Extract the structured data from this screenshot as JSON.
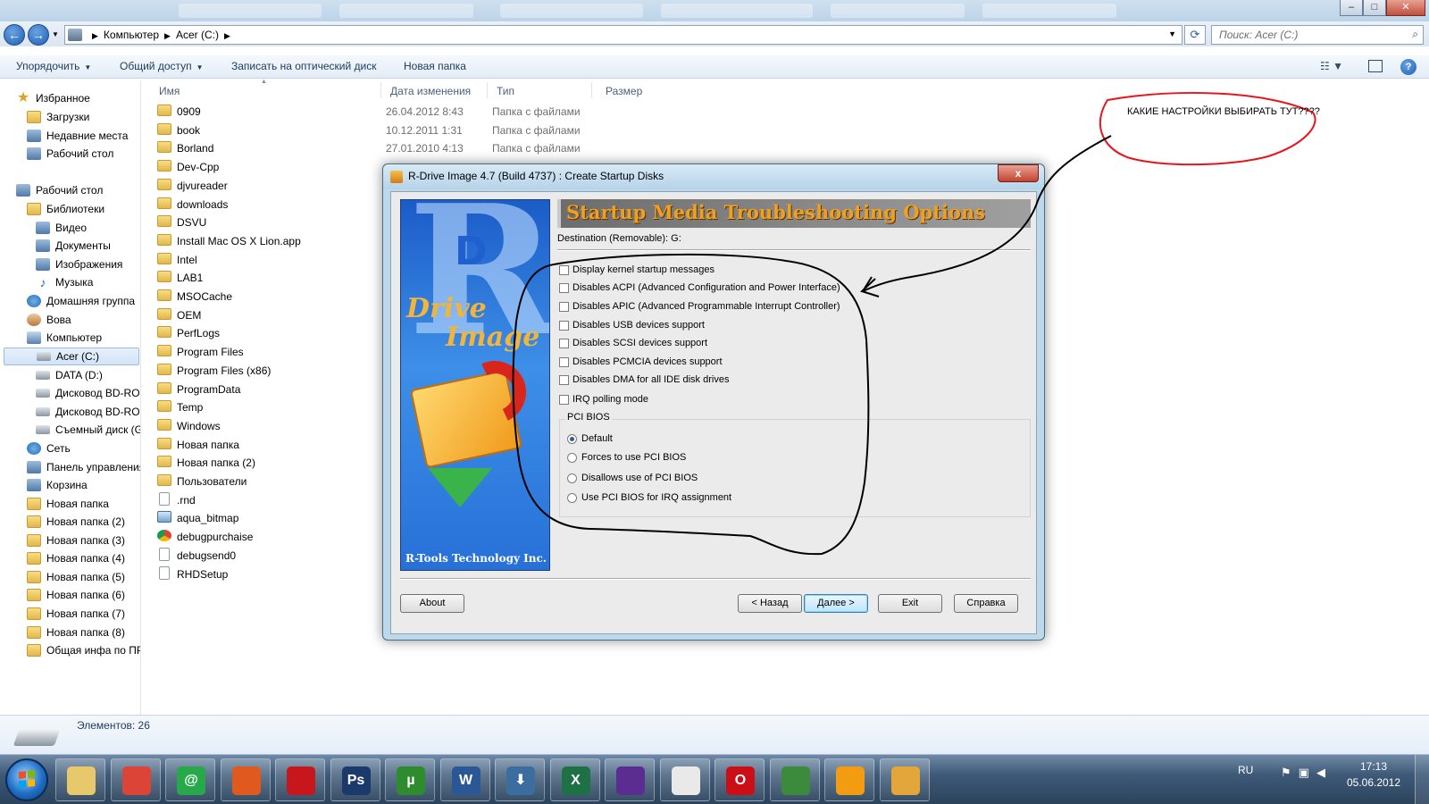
{
  "window": {
    "min": "–",
    "max": "□",
    "close": "✕"
  },
  "address": {
    "crumbs": [
      "Компьютер",
      "Acer (C:)"
    ],
    "search_placeholder": "Поиск: Acer (C:)"
  },
  "commands": [
    "Упорядочить",
    "Общий доступ",
    "Записать на оптический диск",
    "Новая папка"
  ],
  "nav": {
    "items": [
      {
        "label": "Избранное",
        "icon": "star"
      },
      {
        "label": "Загрузки",
        "icon": "folder"
      },
      {
        "label": "Недавние места",
        "icon": "sys"
      },
      {
        "label": "Рабочий стол",
        "icon": "sys"
      },
      {
        "label": "Рабочий стол",
        "icon": "sys"
      },
      {
        "label": "Библиотеки",
        "icon": "folder"
      },
      {
        "label": "Видео",
        "icon": "sys"
      },
      {
        "label": "Документы",
        "icon": "sys"
      },
      {
        "label": "Изображения",
        "icon": "sys"
      },
      {
        "label": "Музыка",
        "icon": "music"
      },
      {
        "label": "Домашняя группа",
        "icon": "net"
      },
      {
        "label": "Вова",
        "icon": "user"
      },
      {
        "label": "Компьютер",
        "icon": "pc"
      },
      {
        "label": "Acer (C:)",
        "icon": "drive"
      },
      {
        "label": "DATA (D:)",
        "icon": "drive"
      },
      {
        "label": "Дисковод BD-ROM",
        "icon": "drive"
      },
      {
        "label": "Дисковод BD-ROM",
        "icon": "drive"
      },
      {
        "label": "Съемный диск (G",
        "icon": "drive"
      },
      {
        "label": "Сеть",
        "icon": "net"
      },
      {
        "label": "Панель управления",
        "icon": "sys"
      },
      {
        "label": "Корзина",
        "icon": "sys"
      },
      {
        "label": "Новая папка",
        "icon": "folder"
      },
      {
        "label": "Новая папка (2)",
        "icon": "folder"
      },
      {
        "label": "Новая папка (3)",
        "icon": "folder"
      },
      {
        "label": "Новая папка (4)",
        "icon": "folder"
      },
      {
        "label": "Новая папка (5)",
        "icon": "folder"
      },
      {
        "label": "Новая папка (6)",
        "icon": "folder"
      },
      {
        "label": "Новая папка (7)",
        "icon": "folder"
      },
      {
        "label": "Новая папка (8)",
        "icon": "folder"
      },
      {
        "label": "Общая инфа по ПР",
        "icon": "folder"
      }
    ]
  },
  "columns": {
    "name": "Имя",
    "date": "Дата изменения",
    "type": "Тип",
    "size": "Размер"
  },
  "files": [
    {
      "name": "0909",
      "date": "26.04.2012 8:43",
      "type": "Папка с файлами",
      "icon": "folder"
    },
    {
      "name": "book",
      "date": "10.12.2011 1:31",
      "type": "Папка с файлами",
      "icon": "folder"
    },
    {
      "name": "Borland",
      "date": "27.01.2010 4:13",
      "type": "Папка с файлами",
      "icon": "folder"
    },
    {
      "name": "Dev-Cpp",
      "date": "",
      "type": "",
      "icon": "folder"
    },
    {
      "name": "djvureader",
      "date": "",
      "type": "",
      "icon": "folder"
    },
    {
      "name": "downloads",
      "date": "",
      "type": "",
      "icon": "folder"
    },
    {
      "name": "DSVU",
      "date": "",
      "type": "",
      "icon": "folder"
    },
    {
      "name": "Install Mac OS X Lion.app",
      "date": "",
      "type": "",
      "icon": "folder"
    },
    {
      "name": "Intel",
      "date": "",
      "type": "",
      "icon": "folder"
    },
    {
      "name": "LAB1",
      "date": "",
      "type": "",
      "icon": "folder"
    },
    {
      "name": "MSOCache",
      "date": "",
      "type": "",
      "icon": "folder"
    },
    {
      "name": "OEM",
      "date": "",
      "type": "",
      "icon": "folder"
    },
    {
      "name": "PerfLogs",
      "date": "",
      "type": "",
      "icon": "folder"
    },
    {
      "name": "Program Files",
      "date": "",
      "type": "",
      "icon": "folder"
    },
    {
      "name": "Program Files (x86)",
      "date": "",
      "type": "",
      "icon": "folder"
    },
    {
      "name": "ProgramData",
      "date": "",
      "type": "",
      "icon": "folder"
    },
    {
      "name": "Temp",
      "date": "",
      "type": "",
      "icon": "folder"
    },
    {
      "name": "Windows",
      "date": "",
      "type": "",
      "icon": "folder"
    },
    {
      "name": "Новая папка",
      "date": "",
      "type": "",
      "icon": "folder"
    },
    {
      "name": "Новая папка (2)",
      "date": "",
      "type": "",
      "icon": "folder"
    },
    {
      "name": "Пользователи",
      "date": "",
      "type": "",
      "icon": "folder"
    },
    {
      "name": ".rnd",
      "date": "",
      "type": "",
      "icon": "file"
    },
    {
      "name": "aqua_bitmap",
      "date": "",
      "type": "",
      "icon": "bmp"
    },
    {
      "name": "debugpurchaise",
      "date": "",
      "type": "",
      "icon": "chrome"
    },
    {
      "name": "debugsend0",
      "date": "",
      "type": "",
      "icon": "file"
    },
    {
      "name": "RHDSetup",
      "date": "",
      "type": "",
      "icon": "file"
    }
  ],
  "details": {
    "count": "Элементов: 26"
  },
  "dialog": {
    "title": "R-Drive Image 4.7 (Build 4737) : Create Startup Disks",
    "close": "x",
    "banner": {
      "r": "R",
      "d": "D",
      "line1": "Drive",
      "line2": "Image",
      "brand": "R-Tools Technology Inc."
    },
    "header": "Startup Media Troubleshooting Options",
    "destination": "Destination (Removable): G:",
    "options": [
      "Display kernel startup messages",
      "Disables ACPI (Advanced Configuration and Power Interface)",
      "Disables APIC (Advanced Programmable Interrupt Controller)",
      "Disables USB devices support",
      "Disables SCSI devices support",
      "Disables PCMCIA devices support",
      "Disables DMA for all IDE disk drives",
      "IRQ polling mode"
    ],
    "pci_label": "PCI BIOS",
    "pci_options": [
      {
        "label": "Default",
        "selected": true
      },
      {
        "label": "Forces to use PCI BIOS",
        "selected": false
      },
      {
        "label": "Disallows use of PCI BIOS",
        "selected": false
      },
      {
        "label": "Use PCI BIOS for IRQ assignment",
        "selected": false
      }
    ],
    "buttons": {
      "about": "About",
      "back": "< Назад",
      "next": "Далее >",
      "exit": "Exit",
      "help": "Справка"
    }
  },
  "annotation": {
    "text": "КАКИЕ НАСТРОЙКИ ВЫБИРАТЬ ТУТ????",
    "color": "#e8141c"
  },
  "taskbar": {
    "apps": [
      {
        "name": "explorer",
        "glyph": "",
        "color": "#e7c86b"
      },
      {
        "name": "chrome",
        "glyph": "",
        "color": "#db4437"
      },
      {
        "name": "icq",
        "glyph": "@",
        "color": "#27a84a"
      },
      {
        "name": "burner",
        "glyph": "",
        "color": "#e05a20"
      },
      {
        "name": "acrobat",
        "glyph": "",
        "color": "#c8161d"
      },
      {
        "name": "photoshop",
        "glyph": "Ps",
        "color": "#1b3a6b"
      },
      {
        "name": "utorrent",
        "glyph": "µ",
        "color": "#2e8b2e"
      },
      {
        "name": "word",
        "glyph": "W",
        "color": "#2b5797"
      },
      {
        "name": "downloader",
        "glyph": "⬇",
        "color": "#3b6e9e"
      },
      {
        "name": "excel",
        "glyph": "X",
        "color": "#1e7145"
      },
      {
        "name": "visual-studio",
        "glyph": "",
        "color": "#5c2d91"
      },
      {
        "name": "calendar",
        "glyph": "",
        "color": "#e9e9e9"
      },
      {
        "name": "opera",
        "glyph": "O",
        "color": "#cc0f16"
      },
      {
        "name": "evernote",
        "glyph": "",
        "color": "#3c8a3c"
      },
      {
        "name": "chat",
        "glyph": "",
        "color": "#f39c12"
      },
      {
        "name": "rdrive",
        "glyph": "",
        "color": "#e2a63a"
      }
    ],
    "lang": "RU",
    "time": "17:13",
    "date": "05.06.2012"
  }
}
